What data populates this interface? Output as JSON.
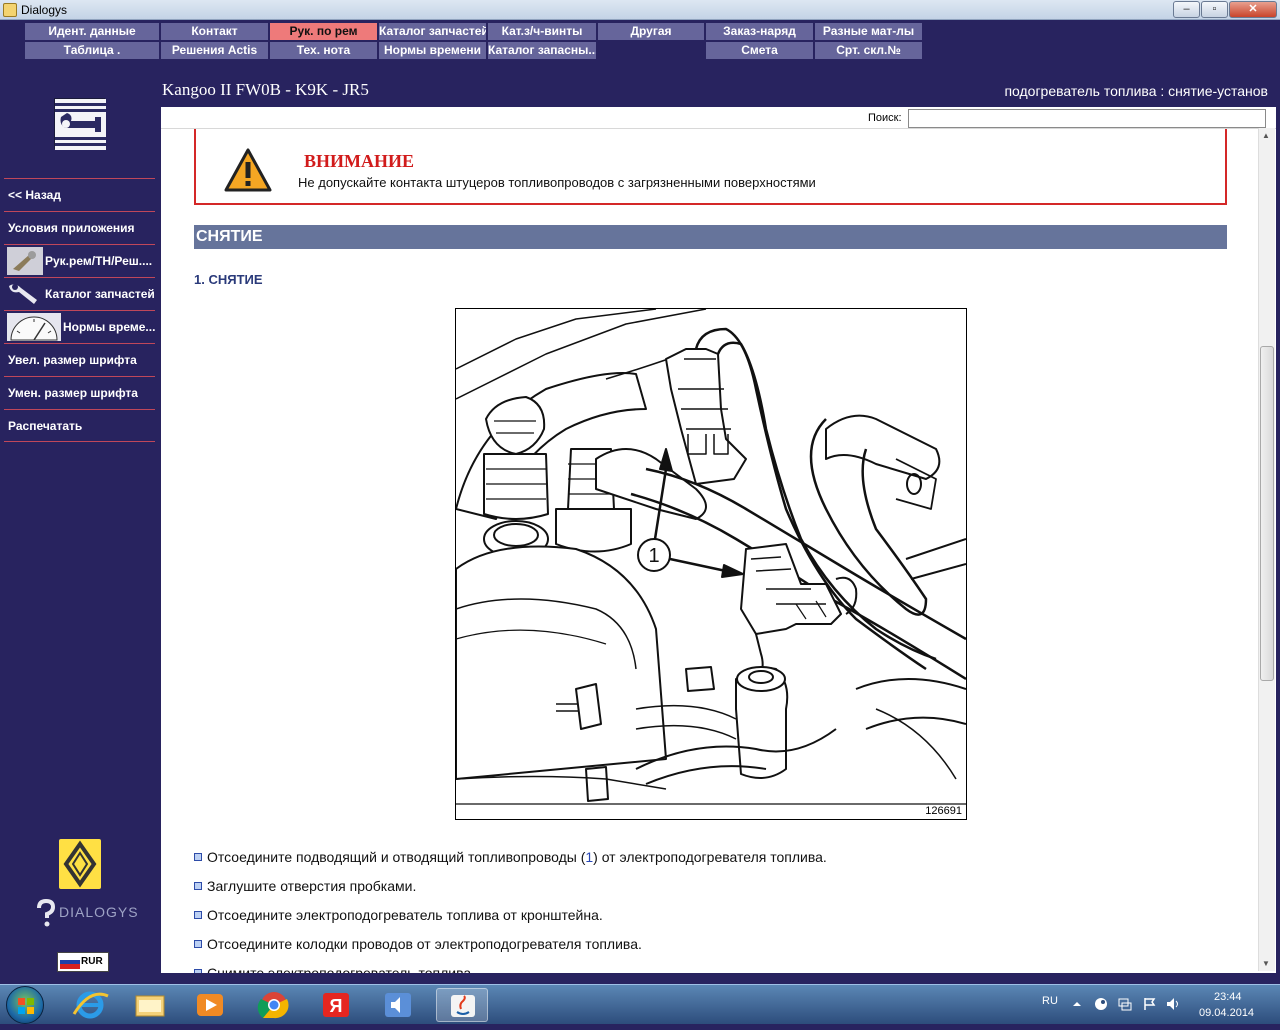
{
  "window": {
    "title": "Dialogys",
    "minimize_glyph": "–",
    "maximize_glyph": "▫",
    "close_glyph": "✕"
  },
  "menu": {
    "row1": [
      "Идент. данные",
      "Контакт",
      "Рук. по рем",
      "Каталог запчастей",
      "Кат.з/ч-винты",
      "Другая",
      "Заказ-наряд",
      "Разные мат-лы"
    ],
    "row2": [
      "Таблица .",
      "Решения Actis",
      "Тех. нота",
      "Нормы времени",
      "Каталог запасны...",
      "",
      "Смета",
      "Срт. скл.№"
    ],
    "active": "Рук. по рем"
  },
  "header": {
    "vehicle": "Kangoo II FW0B - K9K - JR5",
    "subtitle": "подогреватель топлива : снятие-установ"
  },
  "sidebar": {
    "logo": "wrench-icon",
    "items": [
      {
        "label": "<< Назад",
        "icon": ""
      },
      {
        "label": "Условия приложения",
        "icon": ""
      },
      {
        "label": "Рук.рем/ТН/Реш....",
        "icon": "manual-icon"
      },
      {
        "label": "Каталог запчастей",
        "icon": "parts-icon"
      },
      {
        "label": "Нормы време...",
        "icon": "time-icon"
      },
      {
        "label": "Увел. размер шрифта",
        "icon": ""
      },
      {
        "label": "Умен. размер шрифта",
        "icon": ""
      },
      {
        "label": "Распечатать",
        "icon": ""
      }
    ],
    "brand": "DIALOGYS",
    "language": "RUR"
  },
  "search": {
    "label": "Поиск:",
    "value": ""
  },
  "document": {
    "warning_title": "ВНИМАНИЕ",
    "warning_text": "Не допускайте контакта штуцеров топливопроводов с загрязненными поверхностями",
    "section": "СНЯТИЕ",
    "subsection": "1. СНЯТИЕ",
    "figure_number": "126691",
    "figure_callout": "1",
    "steps": [
      {
        "before": "Отсоедините подводящий и отводящий топливопроводы (",
        "ref": "1",
        "after": ") от электроподогревателя топлива."
      },
      {
        "before": "Заглушите отверстия пробками.",
        "ref": "",
        "after": ""
      },
      {
        "before": "Отсоедините электроподогреватель топлива от кронштейна.",
        "ref": "",
        "after": ""
      },
      {
        "before": "Отсоедините колодки проводов от электроподогревателя топлива.",
        "ref": "",
        "after": ""
      },
      {
        "before": "Снимите электроподогреватель топлива.",
        "ref": "",
        "after": ""
      }
    ]
  },
  "taskbar": {
    "apps": [
      "ie-icon",
      "explorer-icon",
      "media-player-icon",
      "chrome-icon",
      "yandex-icon",
      "speaker-app-icon",
      "java-icon"
    ],
    "active_app": "java-icon",
    "yandex_glyph": "Я",
    "lang": "RU",
    "time": "23:44",
    "date": "09.04.2014"
  },
  "colors": {
    "sidebar_bg": "#28235f",
    "menu_btn": "#66659b",
    "menu_active": "#ee7a7a",
    "warning_red": "#d42828",
    "section_bar": "#66749b"
  }
}
